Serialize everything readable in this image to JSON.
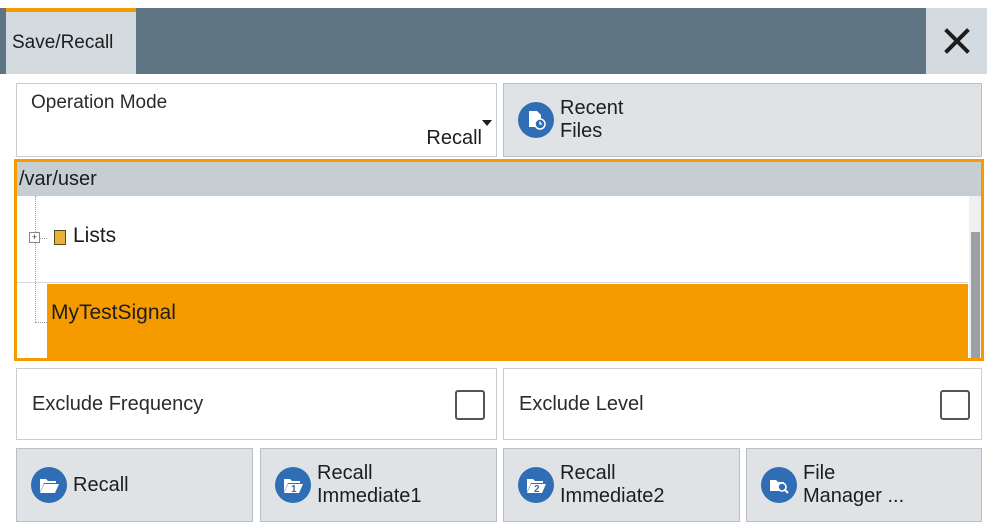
{
  "dialog": {
    "tab_label": "Save/Recall",
    "close_icon": "close-icon"
  },
  "operation_mode": {
    "label": "Operation Mode",
    "value": "Recall"
  },
  "recent_files": {
    "line1": "Recent",
    "line2": "Files",
    "icon": "recent-files-icon"
  },
  "browser": {
    "path": "/var/user",
    "items": [
      {
        "label": "Lists",
        "type": "folder",
        "expandable": true,
        "selected": false
      },
      {
        "label": "MyTestSignal",
        "type": "file",
        "selected": true
      }
    ]
  },
  "options": {
    "exclude_frequency": {
      "label": "Exclude Frequency",
      "checked": false
    },
    "exclude_level": {
      "label": "Exclude Level",
      "checked": false
    }
  },
  "actions": {
    "recall": {
      "label": "Recall",
      "icon": "folder-open-icon"
    },
    "recall_immediate1": {
      "line1": "Recall",
      "line2": "Immediate1",
      "icon": "recall-immediate-1-icon"
    },
    "recall_immediate2": {
      "line1": "Recall",
      "line2": "Immediate2",
      "icon": "recall-immediate-2-icon"
    },
    "file_manager": {
      "line1": "File",
      "line2": "Manager ...",
      "icon": "file-manager-icon"
    }
  },
  "colors": {
    "accent": "#f59b00",
    "titlebar": "#5f7482",
    "button": "#dfe3e6",
    "icon_blue": "#2f6db5"
  }
}
